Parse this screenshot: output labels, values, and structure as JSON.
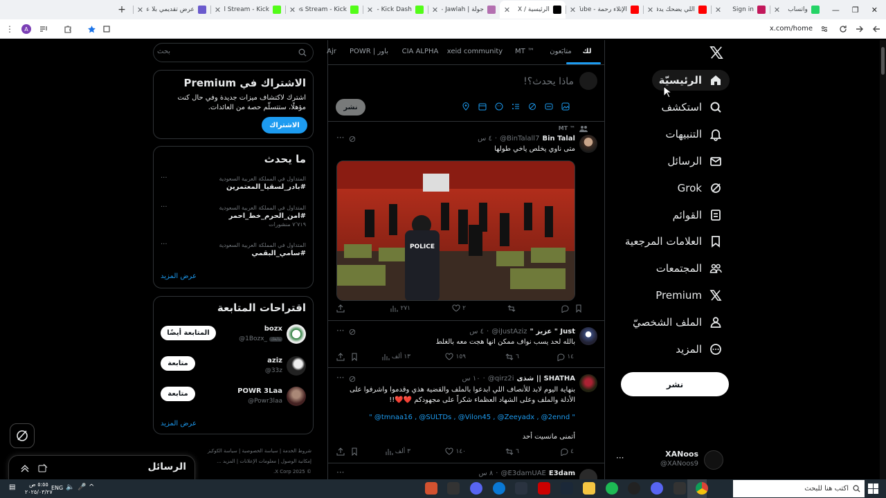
{
  "browser": {
    "tabs": [
      {
        "title": "واتساب",
        "fav_color": "#25d366",
        "active": false
      },
      {
        "title": "Sign in",
        "fav_color": "#c2185b",
        "active": false
      },
      {
        "title": "اللي يضحك يدفع",
        "fav_color": "#ff0000",
        "active": false
      },
      {
        "title": "الإتلاء رحمة - Tube",
        "fav_color": "#ff0000",
        "active": false
      },
      {
        "title": "الرئيسية / X",
        "fav_color": "#000000",
        "active": true
      },
      {
        "title": "جولة | Jawlah - مد",
        "fav_color": "#b36fb0",
        "active": false
      },
      {
        "title": "Stream - Kick Dash",
        "fav_color": "#53fc18",
        "active": false
      },
      {
        "title": "XANoos Stream - Kick",
        "fav_color": "#53fc18",
        "active": false
      },
      {
        "title": "BinTalall Stream - Kick",
        "fav_color": "#53fc18",
        "active": false
      },
      {
        "title": "عرض تقديمي بلا عنوان",
        "fav_color": "#6a5acd",
        "active": false
      }
    ],
    "new_tab": "+",
    "url": "x.com/home"
  },
  "x": {
    "nav": [
      {
        "label": "الرئيسيّة",
        "icon": "home-icon",
        "active": true
      },
      {
        "label": "استكشف",
        "icon": "search-icon",
        "active": false
      },
      {
        "label": "التنبيهات",
        "icon": "bell-icon",
        "active": false
      },
      {
        "label": "الرسائل",
        "icon": "mail-icon",
        "active": false
      },
      {
        "label": "Grok",
        "icon": "grok-icon",
        "active": false
      },
      {
        "label": "القوائم",
        "icon": "list-icon",
        "active": false
      },
      {
        "label": "العلامات المرجعية",
        "icon": "bookmark-icon",
        "active": false
      },
      {
        "label": "المجتمعات",
        "icon": "communities-icon",
        "active": false
      },
      {
        "label": "Premium",
        "icon": "x-logo-icon",
        "active": false
      },
      {
        "label": "الملف الشخصيّ",
        "icon": "person-icon",
        "active": false
      },
      {
        "label": "المزيد",
        "icon": "more-circle-icon",
        "active": false
      }
    ],
    "post_button": "نشر",
    "account": {
      "name": "XANoos",
      "handle": "@XANoos9"
    },
    "timeline_tabs": [
      "لك",
      "متابَعون",
      "MT ™",
      "xeid community",
      "CIA ALPHA",
      "POWR | باور",
      "Ajr"
    ],
    "compose": {
      "placeholder": "ماذا يحدث؟!",
      "post": "نشر"
    },
    "tweets": [
      {
        "context": "MT ™",
        "name": "Bin Talal",
        "handle": "@BinTalall7",
        "time": "٤ س",
        "text": "متى ناوي يخلص ياخي طولها",
        "has_image": true,
        "image_text": "POLICE",
        "replies": "",
        "retweets": "",
        "likes": "٢",
        "views": "٢٧١"
      },
      {
        "name": "\" عزيز \" Just",
        "handle": "@iJustAziz",
        "time": "٤ س",
        "text": "بالله لحد يسب نواف ممكن انها هجت معه بالغلط",
        "replies": "١٤",
        "retweets": "٦",
        "likes": "١٥٩",
        "views": "١٣ ألف"
      },
      {
        "name": "شذى || SHATHA",
        "handle": "@qirz2i",
        "time": "١٠ س",
        "text": "بنهاية اليوم لابد للأنصاف اللي ابدعوا بالملف والقضية هذي وقدموا واشرفوا على الأدلة والملف وعلى الشهاد العظماء شكراً على مجهودكم ❤️❤️!!",
        "mentions": "\" @tmnaa16 , @SULTDs , @Vilon45 , @Zeeyadx , @2ennd \"",
        "wish": "أتمنى مانسيت أحد",
        "replies": "٤",
        "retweets": "٦",
        "likes": "١٤٠",
        "views": "٣ ألف"
      },
      {
        "name": "E3dam",
        "handle": "@E3damUAE",
        "time": "٨ س"
      }
    ],
    "search_placeholder": "بحث",
    "premium": {
      "title": "الاشتراك في Premium",
      "text": "اشترك لاكتشاف ميزات جديدة وفي حال كنت مؤهلًا، ستتسلّم حصة من العائدات.",
      "button": "الاشتراك"
    },
    "trends": {
      "title": "ما يحدث",
      "items": [
        {
          "context": "المتداول في المملكة العربية السعودية",
          "tag": "#بادر_لسقيا_المعتمرين",
          "count": ""
        },
        {
          "context": "المتداول في المملكة العربية السعودية",
          "tag": "#امن_الحرم_خط_احمر",
          "count": "٧٬٧١٩ منشورات"
        },
        {
          "context": "المتداول في المملكة العربية السعودية",
          "tag": "#سامي_البقمي",
          "count": ""
        }
      ],
      "show_more": "عرض المزيد"
    },
    "follow": {
      "title": "اقتراحات المتابعة",
      "items": [
        {
          "name": "bozx",
          "handle": "@1Bozx_",
          "button": "المتابعة أيضًا",
          "badge": "يتابعك"
        },
        {
          "name": "aziz",
          "handle": "@33z",
          "button": "متابعة"
        },
        {
          "name": "POWR 3Laa",
          "handle": "@Powr3laa",
          "button": "متابعة"
        }
      ],
      "show_more": "عرض المزيد"
    },
    "footer": [
      "شروط الخدمة",
      "سياسة الخصوصية",
      "سياسة الكوكيز",
      "إمكانية الوصول",
      "معلومات الإعلانات",
      "المزيد ...",
      "© 2025 X Corp."
    ],
    "messages_drawer": "الرسائل"
  },
  "taskbar": {
    "search": "اكتب هنا للبحث",
    "time": "٥:٥٥ ص",
    "date": "٢٠٢٥/٠٣/٢٧",
    "lang": "ENG"
  }
}
